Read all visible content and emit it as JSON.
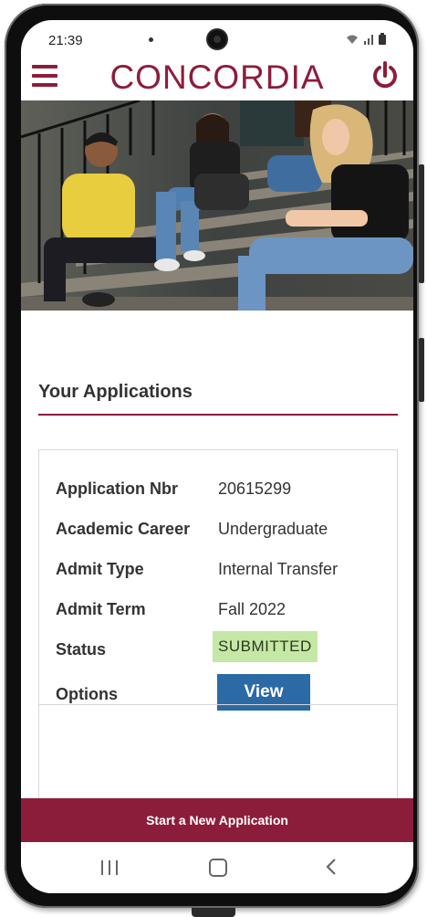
{
  "status_bar": {
    "time": "21:39"
  },
  "app": {
    "logo_text": "CONCORDIA",
    "brand_color": "#8c1d3a",
    "menu_icon": "hamburger-menu-icon",
    "logout_icon": "power-icon"
  },
  "hero": {
    "alt": "Students sitting on outdoor stairs"
  },
  "applications": {
    "title": "Your Applications",
    "rows": [
      {
        "label": "Application Nbr",
        "value": "20615299"
      },
      {
        "label": "Academic Career",
        "value": "Undergraduate"
      },
      {
        "label": "Admit Type",
        "value": "Internal Transfer"
      },
      {
        "label": "Admit Term",
        "value": "Fall 2022"
      }
    ],
    "status_label": "Status",
    "status_value": "SUBMITTED",
    "status_color": "#c6e8a6",
    "options_label": "Options",
    "view_button": "View",
    "view_color": "#2c6aa6"
  },
  "footer": {
    "new_application_button": "Start a New Application"
  },
  "navigation": {
    "recent_icon": "recent-apps-icon",
    "home_icon": "home-icon",
    "back_icon": "back-icon"
  }
}
